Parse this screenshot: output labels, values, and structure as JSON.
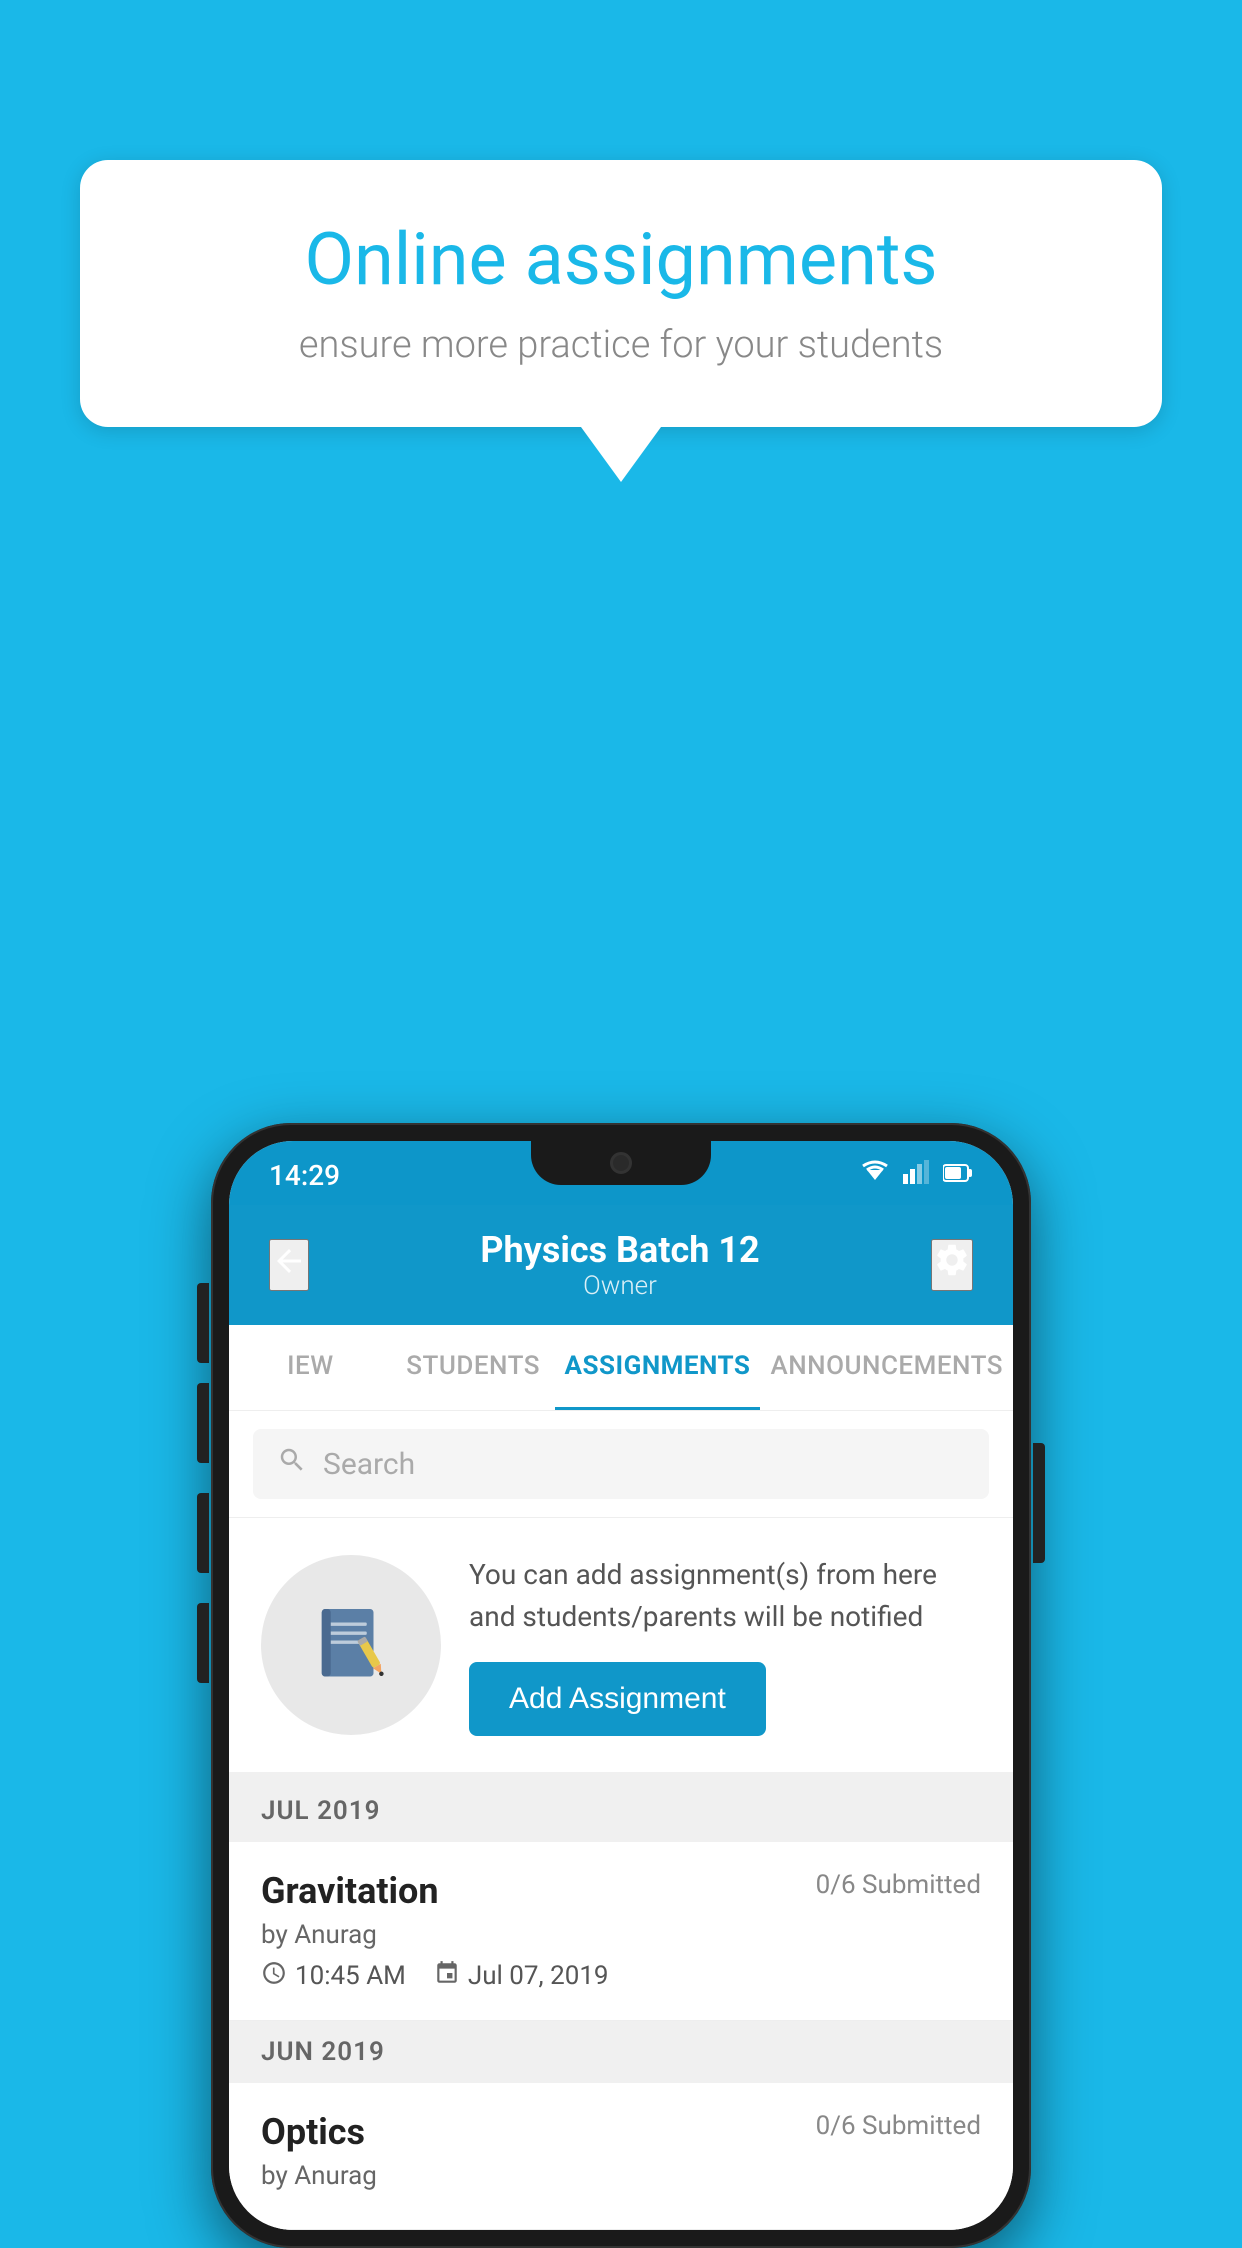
{
  "background_color": "#1ab8e8",
  "speech_bubble": {
    "title": "Online assignments",
    "subtitle": "ensure more practice for your students"
  },
  "phone": {
    "status_bar": {
      "time": "14:29",
      "wifi": "▼▲",
      "signal": "▲",
      "battery": "▊"
    },
    "header": {
      "title": "Physics Batch 12",
      "subtitle": "Owner",
      "back_label": "←",
      "settings_label": "⚙"
    },
    "tabs": [
      {
        "label": "IEW",
        "active": false
      },
      {
        "label": "STUDENTS",
        "active": false
      },
      {
        "label": "ASSIGNMENTS",
        "active": true
      },
      {
        "label": "ANNOUNCEMENTS",
        "active": false
      }
    ],
    "search": {
      "placeholder": "Search"
    },
    "empty_state": {
      "description": "You can add assignment(s) from here and students/parents will be notified",
      "button_label": "Add Assignment"
    },
    "sections": [
      {
        "month": "JUL 2019",
        "assignments": [
          {
            "name": "Gravitation",
            "submitted": "0/6 Submitted",
            "by": "by Anurag",
            "time": "10:45 AM",
            "date": "Jul 07, 2019"
          }
        ]
      },
      {
        "month": "JUN 2019",
        "assignments": [
          {
            "name": "Optics",
            "submitted": "0/6 Submitted",
            "by": "by Anurag",
            "time": "",
            "date": ""
          }
        ]
      }
    ]
  }
}
